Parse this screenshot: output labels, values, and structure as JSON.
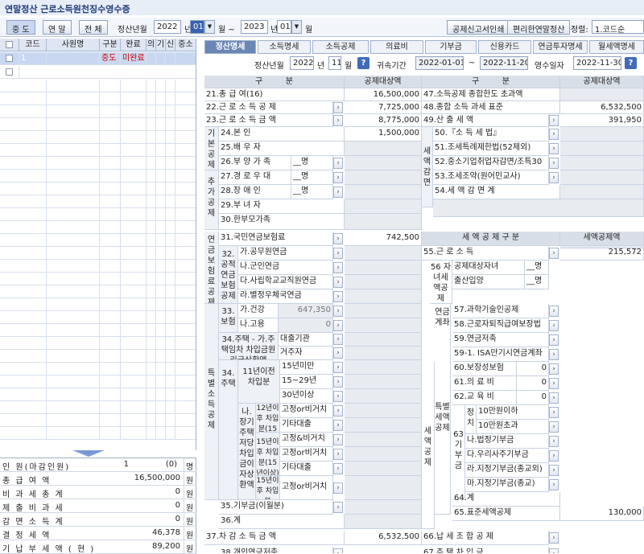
{
  "title": "연말정산 근로소득원천징수영수증",
  "toolbar": {
    "btn_mid": "중 도",
    "btn_year": "연 말",
    "btn_all": "전 체",
    "year_label": "정산년월",
    "year_value": "2022",
    "year_unit": "년",
    "month_from": "01",
    "month_to_label": "월 ~",
    "year_to": "2023",
    "month_to": "01",
    "month_unit": "월",
    "print_btn": "공제신고서인쇄",
    "easy_btn": "편리한연말정산",
    "sort_label": "정렬:",
    "sort_value": "1.코드순"
  },
  "left": {
    "headers": [
      "코드",
      "사원명",
      "구분",
      "완료",
      "의",
      "기",
      "신",
      "중소"
    ],
    "row1": {
      "code": "1",
      "type": "중도",
      "done": "미완료"
    }
  },
  "summary": [
    {
      "label": "인 원(마감인원)",
      "v1": "1",
      "v2": "(0)",
      "unit": "명"
    },
    {
      "label": "총 급 여 액",
      "v1": "16,500,000",
      "unit": "원"
    },
    {
      "label": "비 과 세 총 계",
      "v1": "0",
      "unit": "원"
    },
    {
      "label": "제 출 비 과 세",
      "v1": "0",
      "unit": "원"
    },
    {
      "label": "감 면 소 득 계",
      "v1": "0",
      "unit": "원"
    },
    {
      "label": "결 정 세 액",
      "v1": "46,378",
      "unit": "원"
    },
    {
      "label": "기 납 부 세 액 ( 현 )",
      "v1": "89,200",
      "unit": "원"
    }
  ],
  "tabs": [
    "정산명세",
    "소득명세",
    "소득공제",
    "의료비",
    "기부금",
    "신용카드",
    "연금투자명세",
    "월세액명세"
  ],
  "period": {
    "year_label": "정산년월",
    "year": "2022",
    "year_unit": "년",
    "month": "11",
    "month_unit": "월",
    "range_label": "귀속기간",
    "from": "2022-01-01",
    "tilde": "~",
    "to": "2022-11-20",
    "receipt_label": "영수일자",
    "receipt": "2022-11-30"
  },
  "head": {
    "gu": "구",
    "bun": "분",
    "amt": "공제대상액",
    "gu2": "구",
    "bun2": "분",
    "amt2": "공제대상액"
  },
  "rows": {
    "r21": "21.총 급 여(16)",
    "v21": "16,500,000",
    "r22": "22.근 로 소 득 공 제",
    "v22": "7,725,000",
    "r23": "23.근 로 소 득 금 액",
    "v23": "8,775,000",
    "grp_basic": "기본공제",
    "grp_add": "추가공제",
    "r24": "24.본 인",
    "v24": "1,500,000",
    "r25": "25.배 우 자",
    "r26": "26.부 양 가 족",
    "r27": "27.경 로 우 대",
    "r28": "28.장 애 인",
    "r29": "29.부 녀 자",
    "r30": "30.한부모가족",
    "cnt": "__명",
    "grp_pension": "연금보험료공제",
    "r31": "31.국민연금보험료",
    "v31": "742,500",
    "r32": "32.공적연금보험공제",
    "r32a": "가.공무원연금",
    "r32b": "나.군인연금",
    "r32c": "다.사립학교교직원연금",
    "r32d": "라.별정우체국연금",
    "grp_special": "특별소득공제",
    "r33": "33.보험",
    "r33a": "가.건강",
    "v33a": "647,350",
    "r33b": "나.고용",
    "v33b": "0",
    "r34": "34.주택 - 가.주택임차 차입금원리금상환액",
    "r34a1": "대출기관",
    "r34a2": "거주자",
    "r34x": "34.주택",
    "r34b": "11년이전 차입분",
    "r34b1": "15년미만",
    "r34b2": "15~29년",
    "r34b3": "30년이상",
    "r34c": "나.장기주택저당차입금이자상환액",
    "r34c1": "12년이후 차입분(15년이상)",
    "r34c1a": "고정or비거치",
    "r34c1b": "기타대출",
    "r34c2": "15년이후 차입분(15년이상)",
    "r34c2a": "고정&비거치",
    "r34c2b": "고정or비거치",
    "r34c2c": "기타대출",
    "r34c3": "15년이후 차입분(10~15년)",
    "r34c3a": "고정or비거치",
    "r35": "35.기부금(이월분)",
    "r36": "36.계",
    "r37": "37.차 감 소 득 금 액",
    "v37": "6,532,500",
    "r38": "38.개인연금저축",
    "r47": "47.소득공제 종합한도 초과액",
    "r48": "48.종합 소득 과세 표준",
    "v48": "6,532,500",
    "r49": "49.산 출 세 액",
    "v49": "391,950",
    "grp_reduce": "세액감면",
    "r50": "50.『소 득 세 법』",
    "r51": "51.조세특례제한법(52제외)",
    "r52": "52.중소기업취업자감면/조특30",
    "r53": "53.조세조약(원어민교사)",
    "r54": "54.세 액 감 면 계",
    "tax_head": "세 액 공 제 구 분",
    "tax_head_amt": "세액공제액",
    "r55": "55.근 로 소 득",
    "v55": "215,572",
    "r56": "56 자녀세액공제",
    "r56a": "공제대상자녀",
    "r56b": "출산입양",
    "grp_pen2": "연금계좌",
    "r57": "57.과학기술인공제",
    "r58": "58.근로자퇴직급여보장법",
    "r59": "59.연금저축",
    "r59_1": "59-1. ISA만기시연금계좌",
    "grp_tax": "세액공제",
    "grp_tax2": "특별세액공제",
    "r60": "60.보장성보험",
    "v60": "0",
    "r61": "61.의 료 비",
    "v61": "0",
    "r62": "62.교 육 비",
    "v62": "0",
    "r63": "63 기부금",
    "r63x": "정치",
    "r63a": "10만원이하",
    "r63b": "10만원초과",
    "r63c": "나.법정기부금",
    "r63d": "다.우리사주기부금",
    "r63e": "라.지정기부금(종교외)",
    "r63f": "마.지정기부금(종교)",
    "r64": "64.계",
    "r65": "65.표준세액공제",
    "v65": "130,000",
    "r66": "66.납 세 조 합 공 제",
    "r67": "67.주 택 차 입 금"
  }
}
